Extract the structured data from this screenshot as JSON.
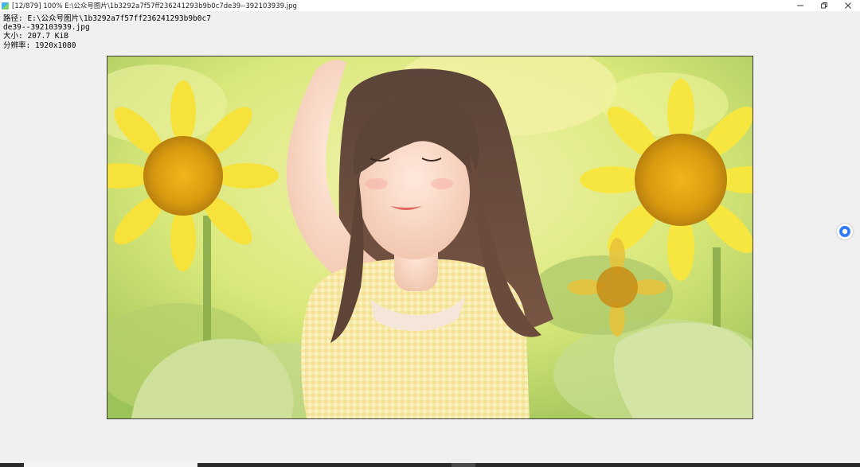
{
  "window": {
    "title": "[12/879] 100% E:\\公众号图片\\1b3292a7f57ff236241293b9b0c7de39--392103939.jpg",
    "app_icon": "image-viewer-app-icon"
  },
  "controls": {
    "minimize_icon": "minimize-icon",
    "restore_icon": "restore-icon",
    "close_icon": "close-icon"
  },
  "info": {
    "path_line1": "路径: E:\\公众号图片\\1b3292a7f57ff236241293b9b0c7",
    "path_line2": "de39--392103939.jpg",
    "size_line": "大小: 207.7 KiB",
    "resolution_line": "分辨率: 1920x1080"
  },
  "image": {
    "description_icon": "photo-sunflowers-girl"
  },
  "floating_button": {
    "icon": "circle-assistant-icon",
    "color": "#2f7bf5"
  },
  "colors": {
    "background": "#f0f0f0",
    "titlebar": "#ffffff",
    "accent": "#2f7bf5"
  }
}
